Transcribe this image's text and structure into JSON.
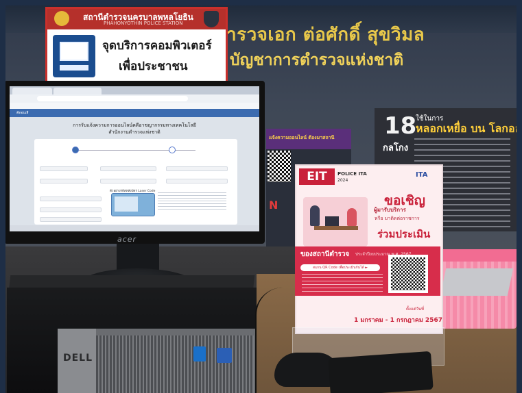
{
  "scene": {
    "wall_headline_line1": "ารวจเอก ต่อศักดิ์ สุขวิมล",
    "wall_headline_line2": "บัญชาการตำรวจแห่งชาติ"
  },
  "sign": {
    "station_th": "สถานีตำรวจนครบาลพหลโยธิน",
    "station_en": "PHAHONYOTHIN POLICE STATION",
    "line1": "จุดบริการคอมพิวเตอร์",
    "line2": "เพื่อประชาชน",
    "icon": "computer-icon"
  },
  "monitor": {
    "brand": "acer",
    "page_header": "ตัดอบเสี",
    "page_title_line1": "การรับแจ้งความการออนไลน์คดีอาชญากรรมทางเทคโนโลยี",
    "page_title_line2": "สำนักงานตำรวจแห่งชาติ",
    "laser_code_label": "ตัวอย่างรหัสหลังบัตร Laser Code"
  },
  "computer": {
    "brand": "DELL"
  },
  "poster_18": {
    "number": "18",
    "kalkong": "กลโกง",
    "head1": "ใช้ในการ",
    "head2": "หลอกเหยื่อ บน โลกออนไลน์"
  },
  "poster_back": {
    "head_text": "แจ้งความออนไลน์ ต้องมาสถานี"
  },
  "ita_poster": {
    "eit": "EIT",
    "police_ita": "POLICE ITA",
    "year": "2024",
    "ita_logo": "ITA",
    "invite": "ขอเชิญ",
    "sub1": "ผู้มารับบริการ",
    "sub2": "หรือ มาติดต่อราชการ",
    "join": "ร่วมประเมิน",
    "station": "ของสถานีตำรวจ",
    "period": "ประจำปีงบประมาณ พ.ศ. 2567",
    "scan": "สแกน QR Code เพื่อประเมินกันได้ ►",
    "from_label": "ตั้งแต่วันที่",
    "date_range": "1 มกราคม - 1 กรกฎาคม 2567"
  }
}
